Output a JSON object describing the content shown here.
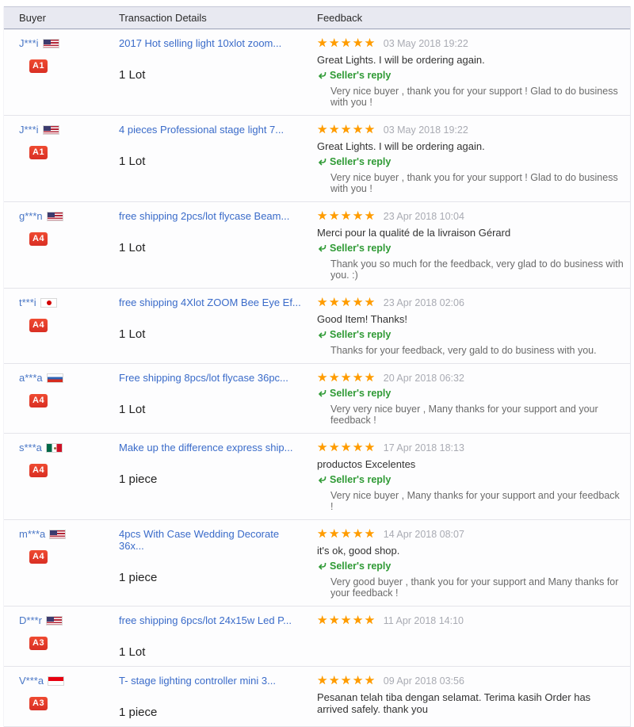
{
  "header": {
    "columns": [
      "Buyer",
      "Transaction Details",
      "Feedback"
    ]
  },
  "seller_reply_label": "Seller's reply",
  "colors": {
    "star": "#ff9c00",
    "badge": "#e2392c",
    "link": "#3a6bc9",
    "reply_green": "#2f9a35"
  },
  "rows": [
    {
      "buyer": {
        "name": "J***i",
        "country": "us",
        "badge": "A1"
      },
      "transaction": {
        "title": "2017 Hot selling light 10xlot zoom...",
        "quantity": "1 Lot"
      },
      "feedback": {
        "stars": 5,
        "date": "03 May 2018 19:22",
        "comment": "Great Lights. I will be ordering again.",
        "reply": "Very nice buyer , thank you for your support ! Glad to do business with you !"
      }
    },
    {
      "buyer": {
        "name": "J***i",
        "country": "us",
        "badge": "A1"
      },
      "transaction": {
        "title": "4 pieces Professional stage light 7...",
        "quantity": "1 Lot"
      },
      "feedback": {
        "stars": 5,
        "date": "03 May 2018 19:22",
        "comment": "Great Lights. I will be ordering again.",
        "reply": "Very nice buyer , thank you for your support ! Glad to do business with you !"
      }
    },
    {
      "buyer": {
        "name": "g***n",
        "country": "us",
        "badge": "A4"
      },
      "transaction": {
        "title": "free shipping 2pcs/lot flycase Beam...",
        "quantity": "1 Lot"
      },
      "feedback": {
        "stars": 5,
        "date": "23 Apr 2018 10:04",
        "comment": "Merci pour la qualité de la livraison Gérard",
        "reply": "Thank you so much for the feedback, very glad to do business with you. :)"
      }
    },
    {
      "buyer": {
        "name": "t***i",
        "country": "jp",
        "badge": "A4"
      },
      "transaction": {
        "title": "free shipping 4Xlot ZOOM Bee Eye Ef...",
        "quantity": "1 Lot"
      },
      "feedback": {
        "stars": 5,
        "date": "23 Apr 2018 02:06",
        "comment": "Good Item! Thanks!",
        "reply": "Thanks for your feedback, very gald to do business with you."
      }
    },
    {
      "buyer": {
        "name": "a***a",
        "country": "ru",
        "badge": "A4"
      },
      "transaction": {
        "title": "Free shipping 8pcs/lot flycase 36pc...",
        "quantity": "1 Lot"
      },
      "feedback": {
        "stars": 5,
        "date": "20 Apr 2018 06:32",
        "comment": "",
        "reply": "Very very nice buyer , Many thanks for your support and your feedback !"
      }
    },
    {
      "buyer": {
        "name": "s***a",
        "country": "mx",
        "badge": "A4"
      },
      "transaction": {
        "title": "Make up the difference express ship...",
        "quantity": "1 piece"
      },
      "feedback": {
        "stars": 5,
        "date": "17 Apr 2018 18:13",
        "comment": "productos Excelentes",
        "reply": "Very nice buyer , Many thanks for your support and your feedback !"
      }
    },
    {
      "buyer": {
        "name": "m***a",
        "country": "us",
        "badge": "A4"
      },
      "transaction": {
        "title": "4pcs With Case Wedding Decorate 36x...",
        "quantity": "1 piece"
      },
      "feedback": {
        "stars": 5,
        "date": "14 Apr 2018 08:07",
        "comment": "it's ok, good shop.",
        "reply": "Very good buyer , thank you for your support and Many thanks for your feedback !"
      }
    },
    {
      "buyer": {
        "name": "D***r",
        "country": "us",
        "badge": "A3"
      },
      "transaction": {
        "title": "free shipping 6pcs/lot 24x15w Led P...",
        "quantity": "1 Lot"
      },
      "feedback": {
        "stars": 5,
        "date": "11 Apr 2018 14:10",
        "comment": "",
        "reply": null
      }
    },
    {
      "buyer": {
        "name": "V***a",
        "country": "id",
        "badge": "A3"
      },
      "transaction": {
        "title": "T- stage lighting controller mini 3...",
        "quantity": "1 piece"
      },
      "feedback": {
        "stars": 5,
        "date": "09 Apr 2018 03:56",
        "comment": "Pesanan telah tiba dengan selamat. Terima kasih Order has arrived safely. thank you",
        "reply": null
      }
    }
  ]
}
